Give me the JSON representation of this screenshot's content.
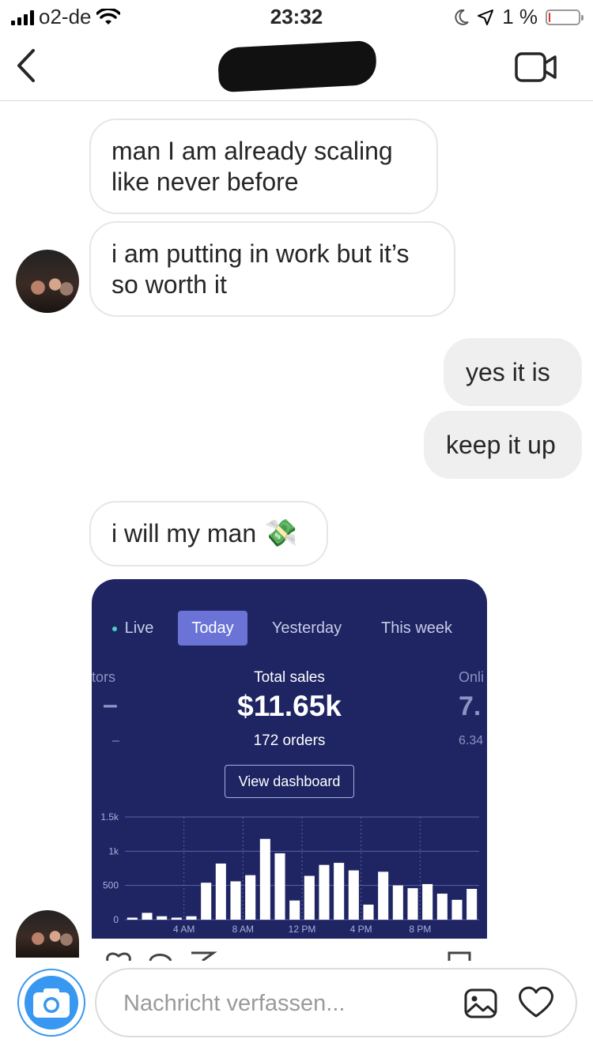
{
  "status_bar": {
    "carrier": "o2-de",
    "time": "23:32",
    "battery_percent": "1 %",
    "battery_level": 0.04,
    "battery_color": "#e0312b"
  },
  "header": {
    "back_icon": "chevron-left-icon",
    "video_icon": "video-camera-icon"
  },
  "messages": [
    {
      "direction": "incoming",
      "lines": [
        "man I am already scaling",
        "like never before"
      ]
    },
    {
      "direction": "incoming",
      "lines": [
        "i am putting in work but it’s",
        "so worth it"
      ]
    },
    {
      "direction": "outgoing",
      "text": "yes it is"
    },
    {
      "direction": "outgoing",
      "text": "keep it up"
    },
    {
      "direction": "incoming",
      "text": "i will my man",
      "emoji": "💸"
    }
  ],
  "shared_image": {
    "tabs": [
      "Live",
      "Today",
      "Yesterday",
      "This week"
    ],
    "active_tab": "Today",
    "left_label": "tors",
    "left_value": "–",
    "left_sub": "–",
    "center_label": "Total sales",
    "center_value": "$11.65k",
    "center_sub": "172 orders",
    "right_label": "Onli",
    "right_value": "7.",
    "right_sub": "6.34",
    "button_label": "View dashboard",
    "chart_data": {
      "type": "bar",
      "ylim": [
        0,
        1500
      ],
      "y_ticks": [
        "1.5k",
        "1k",
        "500",
        "0"
      ],
      "y_tick_values": [
        1500,
        1000,
        500,
        0
      ],
      "x_tick_labels": [
        "4 AM",
        "8 AM",
        "12 PM",
        "4 PM",
        "8 PM"
      ],
      "x_tick_hours": [
        4,
        8,
        12,
        16,
        20
      ],
      "hours": [
        0,
        1,
        2,
        3,
        4,
        5,
        6,
        7,
        8,
        9,
        10,
        11,
        12,
        13,
        14,
        15,
        16,
        17,
        18,
        19,
        20,
        21,
        22,
        23
      ],
      "values": [
        30,
        100,
        50,
        30,
        50,
        540,
        820,
        560,
        650,
        1180,
        970,
        280,
        640,
        800,
        830,
        720,
        220,
        700,
        500,
        460,
        520,
        380,
        290,
        450
      ],
      "bar_color": "#ffffff",
      "grid": true
    }
  },
  "composer": {
    "placeholder": "Nachricht verfassen...",
    "camera_icon": "camera-icon",
    "gallery_icon": "image-icon",
    "like_icon": "heart-icon",
    "accent_color": "#3897f0"
  }
}
